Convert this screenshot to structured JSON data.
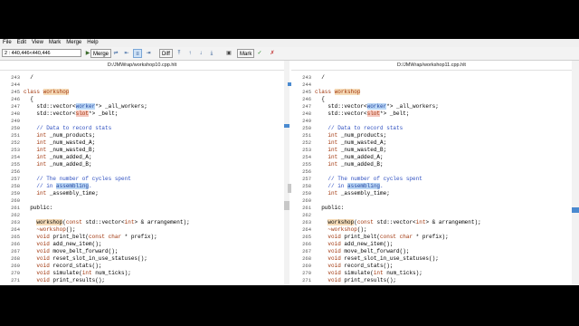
{
  "menu": [
    "File",
    "Edit",
    "View",
    "Mark",
    "Merge",
    "Help"
  ],
  "toolbar": {
    "combo_value": "2 : 440,446<440,446",
    "merge_label": "Merge",
    "diff_label": "Diff",
    "mark_label": "Mark"
  },
  "left": {
    "path": "D:/JMWrap/workshop10.cpp.hlt",
    "lines": [
      {
        "n": "243",
        "t": "  /"
      },
      {
        "n": "244",
        "t": ""
      },
      {
        "n": "245",
        "t": "class workshop"
      },
      {
        "n": "246",
        "t": "  {"
      },
      {
        "n": "247",
        "t": "    std::vector<worker*> _all_workers;"
      },
      {
        "n": "248",
        "t": "    std::vector<slot*> _belt;"
      },
      {
        "n": "249",
        "t": ""
      },
      {
        "n": "250",
        "t": "    // Data to record stats"
      },
      {
        "n": "251",
        "t": "    int _num_products;"
      },
      {
        "n": "252",
        "t": "    int _num_wasted_A;"
      },
      {
        "n": "253",
        "t": "    int _num_wasted_B;"
      },
      {
        "n": "254",
        "t": "    int _num_added_A;"
      },
      {
        "n": "255",
        "t": "    int _num_added_B;"
      },
      {
        "n": "256",
        "t": ""
      },
      {
        "n": "257",
        "t": "    // The number of cycles spent"
      },
      {
        "n": "258",
        "t": "    // in assembling."
      },
      {
        "n": "259",
        "t": "    int _assembly_time;"
      },
      {
        "n": "260",
        "t": ""
      },
      {
        "n": "261",
        "t": "  public:"
      },
      {
        "n": "262",
        "t": ""
      },
      {
        "n": "263",
        "t": "    workshop(const std::vector<int> & arrangement);"
      },
      {
        "n": "264",
        "t": "    ~workshop();"
      },
      {
        "n": "265",
        "t": "    void print_belt(const char * prefix);"
      },
      {
        "n": "266",
        "t": "    void add_new_item();"
      },
      {
        "n": "267",
        "t": "    void move_belt_forward();"
      },
      {
        "n": "268",
        "t": "    void reset_slot_in_use_statuses();"
      },
      {
        "n": "269",
        "t": "    void record_stats();"
      },
      {
        "n": "270",
        "t": "    void simulate(int num_ticks);"
      },
      {
        "n": "271",
        "t": "    void print_results();"
      }
    ]
  },
  "right": {
    "path": "D:/JMWrap/workshop11.cpp.hlt",
    "lines": [
      {
        "n": "243",
        "t": "  /"
      },
      {
        "n": "244",
        "t": ""
      },
      {
        "n": "245",
        "t": "class workshop"
      },
      {
        "n": "246",
        "t": "  {"
      },
      {
        "n": "247",
        "t": "    std::vector<worker*> _all_workers;"
      },
      {
        "n": "248",
        "t": "    std::vector<slot*> _belt;"
      },
      {
        "n": "249",
        "t": ""
      },
      {
        "n": "250",
        "t": "    // Data to record stats"
      },
      {
        "n": "251",
        "t": "    int _num_products;"
      },
      {
        "n": "252",
        "t": "    int _num_wasted_A;"
      },
      {
        "n": "253",
        "t": "    int _num_wasted_B;"
      },
      {
        "n": "254",
        "t": "    int _num_added_A;"
      },
      {
        "n": "255",
        "t": "    int _num_added_B;"
      },
      {
        "n": "256",
        "t": ""
      },
      {
        "n": "257",
        "t": "    // The number of cycles spent"
      },
      {
        "n": "258",
        "t": "    // in assembling."
      },
      {
        "n": "259",
        "t": "    int _assembly_time;"
      },
      {
        "n": "260",
        "t": ""
      },
      {
        "n": "261",
        "t": "  public:"
      },
      {
        "n": "262",
        "t": ""
      },
      {
        "n": "263",
        "t": "    workshop(const std::vector<int> & arrangement);"
      },
      {
        "n": "264",
        "t": "    ~workshop();"
      },
      {
        "n": "265",
        "t": "    void print_belt(const char * prefix);"
      },
      {
        "n": "266",
        "t": "    void add_new_item();"
      },
      {
        "n": "267",
        "t": "    void move_belt_forward();"
      },
      {
        "n": "268",
        "t": "    void reset_slot_in_use_statuses();"
      },
      {
        "n": "269",
        "t": "    void record_stats();"
      },
      {
        "n": "270",
        "t": "    void simulate(int num_ticks);"
      },
      {
        "n": "271",
        "t": "    void print_results();"
      }
    ]
  }
}
